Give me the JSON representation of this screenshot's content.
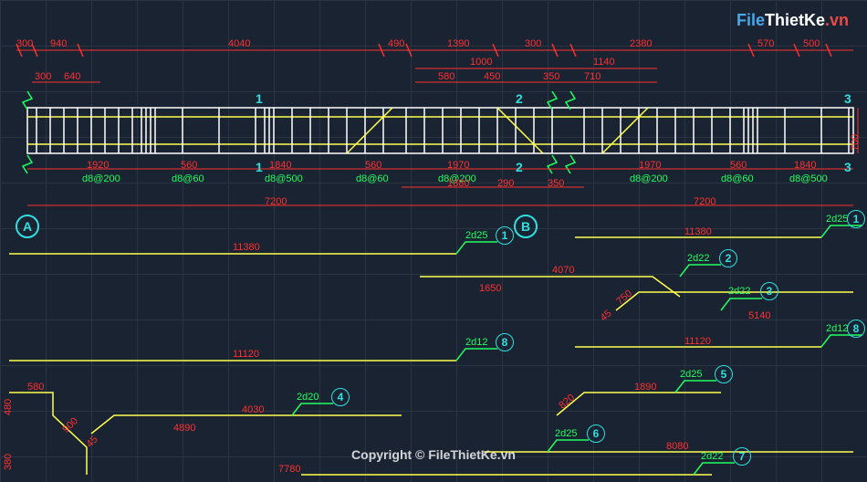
{
  "logo": {
    "part1": "File",
    "part2": "ThietKe",
    "part3": ".vn"
  },
  "watermark": "Copyright © FileThietKe.vn",
  "dimensions_top_row1": {
    "d1": "300",
    "d2": "940",
    "d3": "4040",
    "d4": "490",
    "d5": "1390",
    "d6": "300",
    "d7": "2380",
    "d8": "570",
    "d9": "500"
  },
  "dimensions_top_row2": {
    "d1": "300",
    "d2": "640",
    "d3": "1000",
    "d4": "580",
    "d5": "450",
    "d6": "350",
    "d7": "710",
    "d8": "1140"
  },
  "section_markers": {
    "s1": "1",
    "s2": "2",
    "s3": "3"
  },
  "beam_height": "700",
  "dimensions_bottom_row1": {
    "d1": "1920",
    "d2": "560",
    "d3": "1840",
    "d4": "560",
    "d5": "1970",
    "d6": "1970",
    "d7": "560",
    "d8": "1840"
  },
  "stirrup_labels": {
    "s1": "d8@200",
    "s2": "d8@60",
    "s3": "d8@500",
    "s4": "d8@60",
    "s5": "d8@200",
    "s6": "d8@200",
    "s7": "d8@60",
    "s8": "d8@500"
  },
  "dimensions_bottom_row2": {
    "d1": "1880",
    "d2": "290",
    "d3": "350"
  },
  "span_dims": {
    "span1": "7200",
    "span2": "7200"
  },
  "grid_bubbles": {
    "a": "A",
    "b": "B"
  },
  "rebar_schedule": {
    "bar1": {
      "label": "2d25",
      "num": "1",
      "len": "11380"
    },
    "bar1b": {
      "label": "2d25",
      "num": "1",
      "len": "11380"
    },
    "bar2": {
      "label": "2d22",
      "num": "2",
      "len": "4070"
    },
    "bar2_sub": "1650",
    "bar3": {
      "label": "2d22",
      "num": "3",
      "len": "5140"
    },
    "bar3_sub": "750",
    "bar8": {
      "label": "2d12",
      "num": "8",
      "len": "11120"
    },
    "bar8b": {
      "label": "2d12",
      "num": "8",
      "len": "11120"
    },
    "bar4": {
      "label": "2d20",
      "num": "4",
      "len": "4030"
    },
    "bar4_sub": "4890",
    "bar5": {
      "label": "2d25",
      "num": "5",
      "len": "1890"
    },
    "bar5_sub": "820",
    "bar6": {
      "label": "2d25",
      "num": "6",
      "len": "8080"
    },
    "bar7": {
      "label": "2d22",
      "num": "7",
      "len": "7780"
    },
    "bar_left": {
      "d1": "580",
      "d2": "480",
      "d3": "380",
      "d4": "900",
      "ang": "45"
    },
    "angle45": "45"
  }
}
